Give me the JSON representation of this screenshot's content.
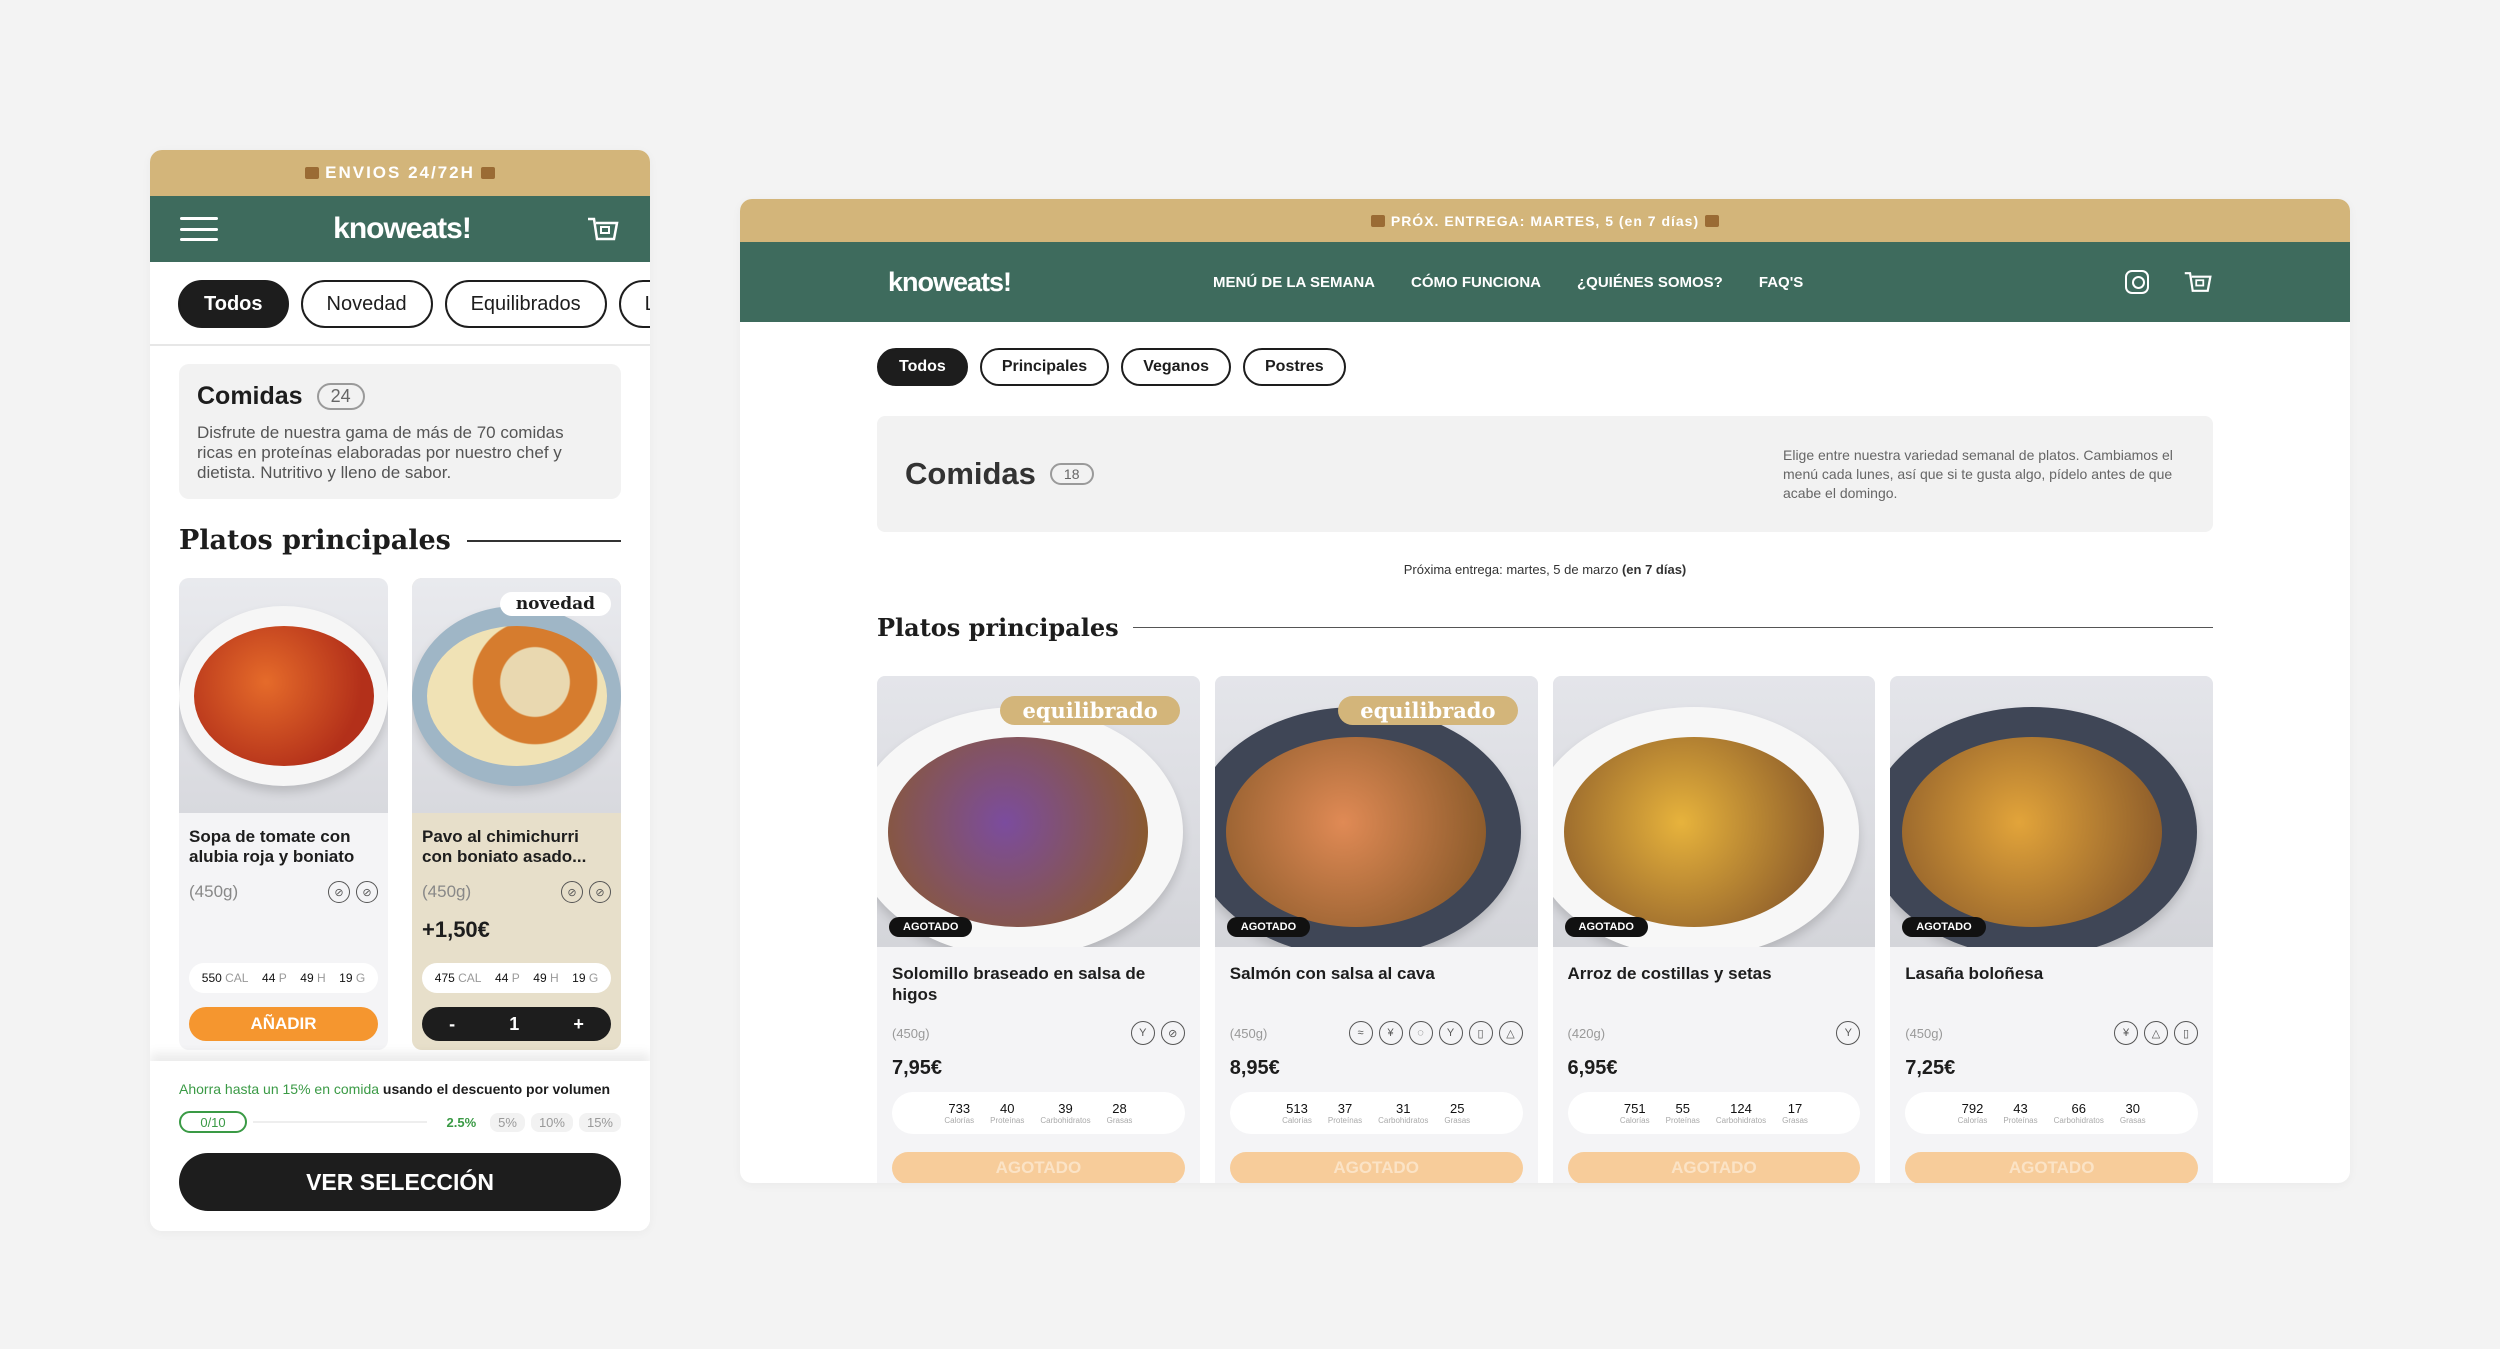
{
  "mobile": {
    "top_banner": "ENVIOS 24/72H",
    "logo": "knoweats!",
    "chips": [
      "Todos",
      "Novedad",
      "Equilibrados",
      "Los m"
    ],
    "info": {
      "title": "Comidas",
      "count": "24",
      "description": "Disfrute de nuestra gama de más de 70 comidas ricas en proteínas elaboradas por nuestro chef y dietista. Nutritivo y lleno de sabor."
    },
    "section_title": "Platos principales",
    "cards": [
      {
        "name": "Sopa de tomate con alubia roja y boniato",
        "weight": "(450g)",
        "price": "",
        "macros": {
          "cal": "550",
          "p": "44",
          "h": "49",
          "g": "19"
        },
        "button": "AÑADIR",
        "food_color": "#c63a1a"
      },
      {
        "name": "Pavo al chimichurri con boniato asado...",
        "weight": "(450g)",
        "price": "+1,50€",
        "tag": "novedad",
        "macros": {
          "cal": "475",
          "p": "44",
          "h": "49",
          "g": "19"
        },
        "stepper": {
          "minus": "-",
          "qty": "1",
          "plus": "+"
        },
        "food_color": "#d99a4a"
      }
    ],
    "macro_units": {
      "cal": "CAL",
      "p": "P",
      "h": "H",
      "g": "G"
    },
    "footer": {
      "promo_green": "Ahorra hasta un 15% en comida",
      "promo_rest": "usando el descuento por volumen",
      "progress": "0/10",
      "tiers": [
        "2.5%",
        "5%",
        "10%",
        "15%"
      ],
      "cta": "VER SELECCIÓN"
    }
  },
  "desktop": {
    "top_banner": "PRÓX. ENTREGA: MARTES, 5 (en 7 días)",
    "logo": "knoweats!",
    "nav_links": [
      "MENÚ DE LA SEMANA",
      "CÓMO FUNCIONA",
      "¿QUIÉNES SOMOS?",
      "FAQ'S"
    ],
    "chips": [
      "Todos",
      "Principales",
      "Veganos",
      "Postres"
    ],
    "info": {
      "title": "Comidas",
      "count": "18",
      "description": "Elige entre nuestra variedad semanal de platos. Cambiamos el menú cada lunes, así que si te gusta algo, pídelo antes de que acabe el domingo."
    },
    "delivery": {
      "text": "Próxima entrega: martes, 5 de marzo",
      "bold": "(en 7 días)"
    },
    "section_title": "Platos principales",
    "macro_labels": [
      "Calorías",
      "Proteínas",
      "Carbohidratos",
      "Grasas"
    ],
    "cards": [
      {
        "name": "Solomillo braseado en salsa de higos",
        "weight": "(450g)",
        "price": "7,95€",
        "tag": "equilibrado",
        "status": "AGOTADO",
        "macros": [
          "733",
          "40",
          "39",
          "28"
        ],
        "button": "AGOTADO",
        "icons": [
          "fork-icon",
          "gluten-free-icon"
        ],
        "food_color": "#7b4c9e"
      },
      {
        "name": "Salmón con salsa al cava",
        "weight": "(450g)",
        "price": "8,95€",
        "tag": "equilibrado",
        "status": "AGOTADO",
        "macros": [
          "513",
          "37",
          "31",
          "25"
        ],
        "button": "AGOTADO",
        "icons": [
          "fish-icon",
          "wheat-icon",
          "egg-icon",
          "fork-icon",
          "bottle-icon",
          "flask-icon"
        ],
        "food_color": "#e08a55"
      },
      {
        "name": "Arroz de costillas y setas",
        "weight": "(420g)",
        "price": "6,95€",
        "status": "AGOTADO",
        "macros": [
          "751",
          "55",
          "124",
          "17"
        ],
        "button": "AGOTADO",
        "icons": [
          "fork-icon"
        ],
        "food_color": "#e7b33c"
      },
      {
        "name": "Lasaña boloñesa",
        "weight": "(450g)",
        "price": "7,25€",
        "status": "AGOTADO",
        "macros": [
          "792",
          "43",
          "66",
          "30"
        ],
        "button": "AGOTADO",
        "icons": [
          "wheat-icon",
          "flask-icon",
          "bottle-icon"
        ],
        "food_color": "#e2a43a"
      }
    ]
  }
}
